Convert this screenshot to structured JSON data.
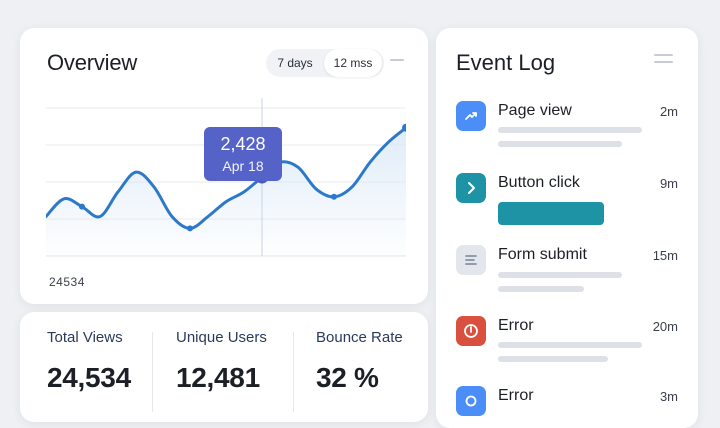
{
  "overview": {
    "title": "Overview",
    "range_options": [
      "7 days",
      "12 mss"
    ],
    "selected_range": "12 mss",
    "footer_value": "24534"
  },
  "chart_data": {
    "type": "area",
    "x": [
      0,
      1,
      2,
      3,
      4,
      5,
      6,
      7,
      8,
      9,
      10,
      11,
      12,
      13,
      14,
      15,
      16,
      17,
      18,
      19,
      20
    ],
    "values": [
      40,
      58,
      50,
      40,
      65,
      85,
      70,
      40,
      28,
      40,
      55,
      65,
      80,
      95,
      90,
      68,
      60,
      70,
      95,
      115,
      130
    ],
    "ylim": [
      0,
      150
    ],
    "grid": true,
    "highlight": {
      "index": 12,
      "value_label": "2,428",
      "date_label": "Apr 18"
    },
    "accent": "#2c79c9",
    "fill": "#dceaf7"
  },
  "stats": [
    {
      "label": "Total Views",
      "value": "24,534"
    },
    {
      "label": "Unique Users",
      "value": "12,481"
    },
    {
      "label": "Bounce Rate",
      "value": "32 %"
    }
  ],
  "event_log": {
    "title": "Event Log",
    "items": [
      {
        "name": "Page view",
        "time": "2m",
        "icon": "trending-arrow-icon",
        "color": "#4c8ef7"
      },
      {
        "name": "Button click",
        "time": "9m",
        "icon": "chevron-right-icon",
        "color": "#1e93a6"
      },
      {
        "name": "Form submit",
        "time": "15m",
        "icon": "list-lines-icon",
        "color": "#e3e7ed"
      },
      {
        "name": "Error",
        "time": "20m",
        "icon": "power-icon",
        "color": "#d9503f"
      },
      {
        "name": "Error",
        "time": "3m",
        "icon": "circle-icon",
        "color": "#4c8ef7"
      }
    ]
  }
}
